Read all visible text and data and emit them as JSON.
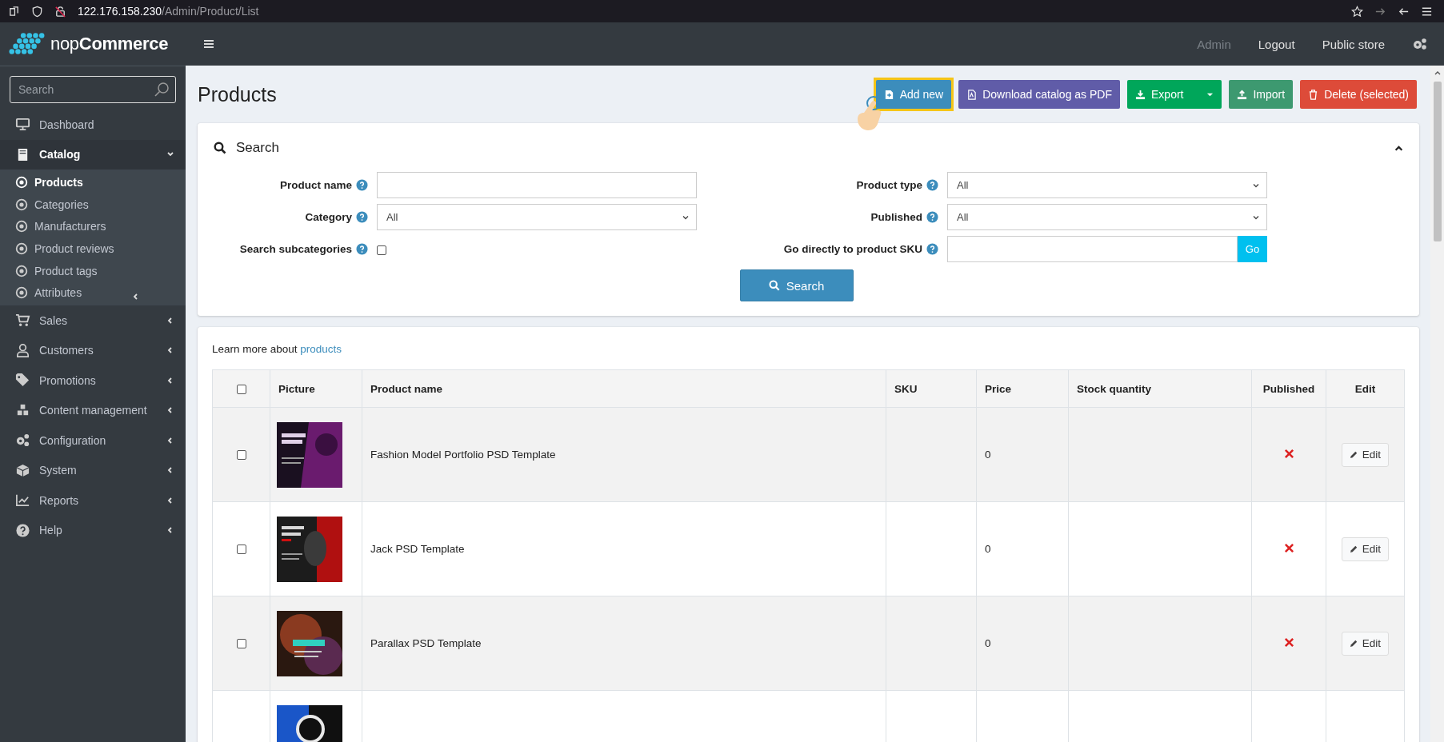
{
  "browser": {
    "url_host": "122.176.158.230",
    "url_path": "/Admin/Product/List"
  },
  "brand": {
    "prefix": "nop",
    "name": "Commerce"
  },
  "header": {
    "links": [
      {
        "label": "Admin",
        "disabled": true
      },
      {
        "label": "Logout",
        "disabled": false
      },
      {
        "label": "Public store",
        "disabled": false
      }
    ]
  },
  "sidebar": {
    "search": {
      "placeholder": "Search"
    },
    "items": [
      {
        "label": "Dashboard",
        "expandable": false,
        "expanded": false
      },
      {
        "label": "Catalog",
        "expandable": true,
        "expanded": true,
        "children": [
          {
            "label": "Products",
            "selected": true,
            "expandable": false
          },
          {
            "label": "Categories",
            "selected": false,
            "expandable": false
          },
          {
            "label": "Manufacturers",
            "selected": false,
            "expandable": false
          },
          {
            "label": "Product reviews",
            "selected": false,
            "expandable": false
          },
          {
            "label": "Product tags",
            "selected": false,
            "expandable": false
          },
          {
            "label": "Attributes",
            "selected": false,
            "expandable": true
          }
        ]
      },
      {
        "label": "Sales",
        "expandable": true,
        "expanded": false
      },
      {
        "label": "Customers",
        "expandable": true,
        "expanded": false
      },
      {
        "label": "Promotions",
        "expandable": true,
        "expanded": false
      },
      {
        "label": "Content management",
        "expandable": true,
        "expanded": false
      },
      {
        "label": "Configuration",
        "expandable": true,
        "expanded": false
      },
      {
        "label": "System",
        "expandable": true,
        "expanded": false
      },
      {
        "label": "Reports",
        "expandable": true,
        "expanded": false
      },
      {
        "label": "Help",
        "expandable": true,
        "expanded": false
      }
    ]
  },
  "page": {
    "title": "Products",
    "actions": [
      {
        "label": "Add new",
        "kind": "add",
        "highlighted": true
      },
      {
        "label": "Download catalog as PDF",
        "kind": "pdf",
        "highlighted": false
      },
      {
        "label": "Export",
        "kind": "export",
        "highlighted": false
      },
      {
        "label": "Import",
        "kind": "import",
        "highlighted": false
      },
      {
        "label": "Delete (selected)",
        "kind": "delete",
        "highlighted": false
      }
    ]
  },
  "search_panel": {
    "title": "Search",
    "expanded": true,
    "left": [
      {
        "label": "Product name",
        "kind": "text"
      },
      {
        "label": "Category",
        "kind": "select",
        "value": "All"
      },
      {
        "label": "Search subcategories",
        "kind": "checkbox",
        "checked": false
      }
    ],
    "right": [
      {
        "label": "Product type",
        "kind": "select",
        "value": "All"
      },
      {
        "label": "Published",
        "kind": "select",
        "value": "All"
      },
      {
        "label": "Go directly to product SKU",
        "kind": "go",
        "button": "Go"
      }
    ],
    "button": "Search"
  },
  "products": {
    "learn_more": "Learn more about",
    "learn_link": "products",
    "columns": [
      "Picture",
      "Product name",
      "SKU",
      "Price",
      "Stock quantity",
      "Published",
      "Edit"
    ],
    "all_checked": false,
    "rows": [
      {
        "kind": "full",
        "checked": false,
        "name": "Fashion Model Portfolio PSD Template",
        "price": "0",
        "published": false,
        "edit": "Edit"
      },
      {
        "kind": "full",
        "checked": false,
        "name": "Jack PSD Template",
        "price": "0",
        "published": false,
        "edit": "Edit"
      },
      {
        "kind": "full",
        "checked": false,
        "name": "Parallax PSD Template",
        "price": "0",
        "published": false,
        "edit": "Edit"
      },
      {
        "kind": "partial"
      }
    ]
  }
}
